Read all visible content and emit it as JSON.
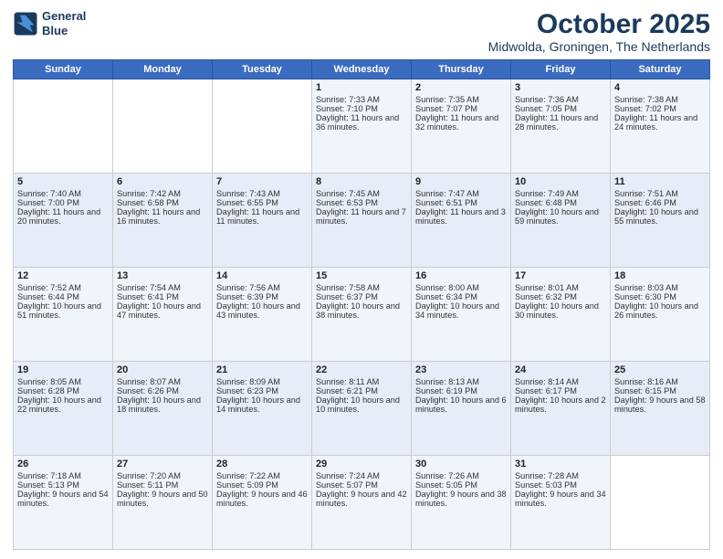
{
  "header": {
    "logo_line1": "General",
    "logo_line2": "Blue",
    "main_title": "October 2025",
    "subtitle": "Midwolda, Groningen, The Netherlands"
  },
  "calendar": {
    "headers": [
      "Sunday",
      "Monday",
      "Tuesday",
      "Wednesday",
      "Thursday",
      "Friday",
      "Saturday"
    ],
    "rows": [
      [
        {
          "day": "",
          "text": ""
        },
        {
          "day": "",
          "text": ""
        },
        {
          "day": "",
          "text": ""
        },
        {
          "day": "1",
          "text": "Sunrise: 7:33 AM\nSunset: 7:10 PM\nDaylight: 11 hours and 36 minutes."
        },
        {
          "day": "2",
          "text": "Sunrise: 7:35 AM\nSunset: 7:07 PM\nDaylight: 11 hours and 32 minutes."
        },
        {
          "day": "3",
          "text": "Sunrise: 7:36 AM\nSunset: 7:05 PM\nDaylight: 11 hours and 28 minutes."
        },
        {
          "day": "4",
          "text": "Sunrise: 7:38 AM\nSunset: 7:02 PM\nDaylight: 11 hours and 24 minutes."
        }
      ],
      [
        {
          "day": "5",
          "text": "Sunrise: 7:40 AM\nSunset: 7:00 PM\nDaylight: 11 hours and 20 minutes."
        },
        {
          "day": "6",
          "text": "Sunrise: 7:42 AM\nSunset: 6:58 PM\nDaylight: 11 hours and 16 minutes."
        },
        {
          "day": "7",
          "text": "Sunrise: 7:43 AM\nSunset: 6:55 PM\nDaylight: 11 hours and 11 minutes."
        },
        {
          "day": "8",
          "text": "Sunrise: 7:45 AM\nSunset: 6:53 PM\nDaylight: 11 hours and 7 minutes."
        },
        {
          "day": "9",
          "text": "Sunrise: 7:47 AM\nSunset: 6:51 PM\nDaylight: 11 hours and 3 minutes."
        },
        {
          "day": "10",
          "text": "Sunrise: 7:49 AM\nSunset: 6:48 PM\nDaylight: 10 hours and 59 minutes."
        },
        {
          "day": "11",
          "text": "Sunrise: 7:51 AM\nSunset: 6:46 PM\nDaylight: 10 hours and 55 minutes."
        }
      ],
      [
        {
          "day": "12",
          "text": "Sunrise: 7:52 AM\nSunset: 6:44 PM\nDaylight: 10 hours and 51 minutes."
        },
        {
          "day": "13",
          "text": "Sunrise: 7:54 AM\nSunset: 6:41 PM\nDaylight: 10 hours and 47 minutes."
        },
        {
          "day": "14",
          "text": "Sunrise: 7:56 AM\nSunset: 6:39 PM\nDaylight: 10 hours and 43 minutes."
        },
        {
          "day": "15",
          "text": "Sunrise: 7:58 AM\nSunset: 6:37 PM\nDaylight: 10 hours and 38 minutes."
        },
        {
          "day": "16",
          "text": "Sunrise: 8:00 AM\nSunset: 6:34 PM\nDaylight: 10 hours and 34 minutes."
        },
        {
          "day": "17",
          "text": "Sunrise: 8:01 AM\nSunset: 6:32 PM\nDaylight: 10 hours and 30 minutes."
        },
        {
          "day": "18",
          "text": "Sunrise: 8:03 AM\nSunset: 6:30 PM\nDaylight: 10 hours and 26 minutes."
        }
      ],
      [
        {
          "day": "19",
          "text": "Sunrise: 8:05 AM\nSunset: 6:28 PM\nDaylight: 10 hours and 22 minutes."
        },
        {
          "day": "20",
          "text": "Sunrise: 8:07 AM\nSunset: 6:26 PM\nDaylight: 10 hours and 18 minutes."
        },
        {
          "day": "21",
          "text": "Sunrise: 8:09 AM\nSunset: 6:23 PM\nDaylight: 10 hours and 14 minutes."
        },
        {
          "day": "22",
          "text": "Sunrise: 8:11 AM\nSunset: 6:21 PM\nDaylight: 10 hours and 10 minutes."
        },
        {
          "day": "23",
          "text": "Sunrise: 8:13 AM\nSunset: 6:19 PM\nDaylight: 10 hours and 6 minutes."
        },
        {
          "day": "24",
          "text": "Sunrise: 8:14 AM\nSunset: 6:17 PM\nDaylight: 10 hours and 2 minutes."
        },
        {
          "day": "25",
          "text": "Sunrise: 8:16 AM\nSunset: 6:15 PM\nDaylight: 9 hours and 58 minutes."
        }
      ],
      [
        {
          "day": "26",
          "text": "Sunrise: 7:18 AM\nSunset: 5:13 PM\nDaylight: 9 hours and 54 minutes."
        },
        {
          "day": "27",
          "text": "Sunrise: 7:20 AM\nSunset: 5:11 PM\nDaylight: 9 hours and 50 minutes."
        },
        {
          "day": "28",
          "text": "Sunrise: 7:22 AM\nSunset: 5:09 PM\nDaylight: 9 hours and 46 minutes."
        },
        {
          "day": "29",
          "text": "Sunrise: 7:24 AM\nSunset: 5:07 PM\nDaylight: 9 hours and 42 minutes."
        },
        {
          "day": "30",
          "text": "Sunrise: 7:26 AM\nSunset: 5:05 PM\nDaylight: 9 hours and 38 minutes."
        },
        {
          "day": "31",
          "text": "Sunrise: 7:28 AM\nSunset: 5:03 PM\nDaylight: 9 hours and 34 minutes."
        },
        {
          "day": "",
          "text": ""
        }
      ]
    ]
  }
}
